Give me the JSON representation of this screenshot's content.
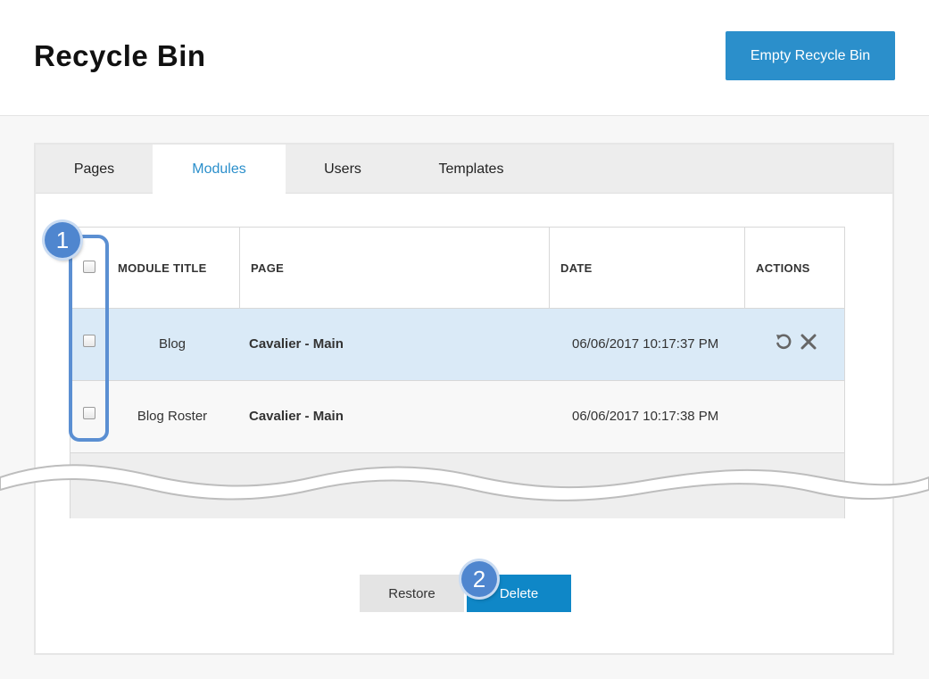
{
  "header": {
    "title": "Recycle Bin",
    "empty_button": "Empty Recycle Bin"
  },
  "tabs": [
    {
      "label": "Pages",
      "active": false
    },
    {
      "label": "Modules",
      "active": true
    },
    {
      "label": "Users",
      "active": false
    },
    {
      "label": "Templates",
      "active": false
    }
  ],
  "table": {
    "columns": [
      "MODULE TITLE",
      "PAGE",
      "DATE",
      "ACTIONS"
    ],
    "rows": [
      {
        "title": "Blog",
        "page": "Cavalier - Main",
        "date": "06/06/2017 10:17:37 PM",
        "selected": true
      },
      {
        "title": "Blog Roster",
        "page": "Cavalier - Main",
        "date": "06/06/2017 10:17:38 PM",
        "selected": false
      }
    ],
    "row_actions": [
      "restore-icon",
      "delete-x-icon"
    ]
  },
  "footer": {
    "restore_label": "Restore",
    "delete_label": "Delete"
  },
  "callouts": [
    "1",
    "2"
  ],
  "colors": {
    "accent": "#2b8fcb",
    "selected_row": "#daeaf7",
    "callout": "#4f86cf"
  }
}
